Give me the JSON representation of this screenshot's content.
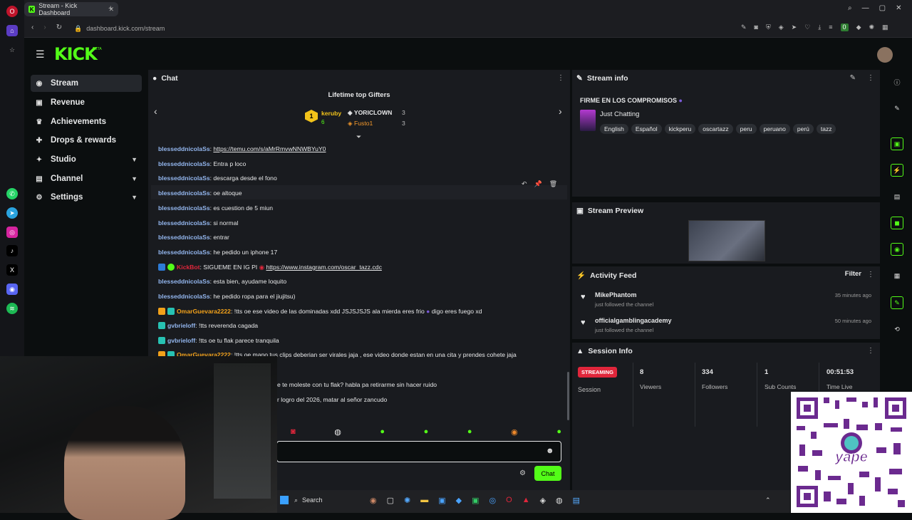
{
  "browser": {
    "tab_title": "Stream - Kick Dashboard",
    "url": "dashboard.kick.com/stream",
    "ext_badge": "0"
  },
  "brand": {
    "logo": "KICK",
    "beta": "BETA",
    "accent": "#53fc18"
  },
  "nav": [
    {
      "label": "Stream",
      "icon": "broadcast-icon",
      "active": true
    },
    {
      "label": "Revenue",
      "icon": "money-icon"
    },
    {
      "label": "Achievements",
      "icon": "trophy-icon"
    },
    {
      "label": "Drops & rewards",
      "icon": "gift-icon"
    },
    {
      "label": "Studio",
      "icon": "studio-icon",
      "expand": true
    },
    {
      "label": "Channel",
      "icon": "channel-icon",
      "expand": true
    },
    {
      "label": "Settings",
      "icon": "gear-icon",
      "expand": true
    }
  ],
  "chat": {
    "title": "Chat",
    "gifters_title": "Lifetime top Gifters",
    "gifters": [
      {
        "rank": "1",
        "name": "keruby",
        "count": "6"
      },
      {
        "name": "YORICLOWN",
        "count": "3"
      },
      {
        "name": "Fusto1",
        "count": "3"
      }
    ],
    "messages": [
      {
        "user": "blesseddnicolaSs",
        "text": "https://temu.com/s/aMrRmvwNNWBYuY0",
        "link": true
      },
      {
        "user": "blesseddnicolaSs",
        "text": "Entra p loco"
      },
      {
        "user": "blesseddnicolaSs",
        "text": "descarga desde el fono"
      },
      {
        "user": "blesseddnicolaSs",
        "text": "oe altoque"
      },
      {
        "user": "blesseddnicolaSs",
        "text": "es cuestion de 5 miun"
      },
      {
        "user": "blesseddnicolaSs",
        "text": "si normal"
      },
      {
        "user": "blesseddnicolaSs",
        "text": "entrar"
      },
      {
        "user": "blesseddnicolaSs",
        "text": "he pedido un iphone 17"
      },
      {
        "user": "KickBot",
        "text": "SIGUEME EN IG PI",
        "link_text": "https://www.instagram.com/oscar_tazz.cdc"
      },
      {
        "user": "blesseddnicolaSs",
        "text": "esta bien, ayudame loquito"
      },
      {
        "user": "blesseddnicolaSs",
        "text": "he pedido ropa para el jiujitsu)"
      },
      {
        "user": "OmarGuevara2222",
        "text": "!tts oe ese video de las dominadas xdd JSJSJSJS ala mierda eres frio",
        "text2": "digo eres fuego xd"
      },
      {
        "user": "gvbrieloff",
        "text": "!tts reverenda cagada"
      },
      {
        "user": "gvbrieloff",
        "text": "!tts oe tu flak parece tranquila"
      },
      {
        "user": "OmarGuevara2222",
        "text": "!tts oe mano tus clips deberian ser virales jaja , ese video donde estan en una cita y prendes cohete jaja"
      },
      {
        "user": "",
        "text": "e te moleste con tu flak? habla pa retirarme sin hacer ruido"
      },
      {
        "user": "",
        "text": "r logro del 2026, matar al señor zancudo"
      }
    ],
    "send_label": "Chat"
  },
  "stream_info": {
    "title": "Stream info",
    "stream_title": "FIRME EN LOS COMPROMISOS",
    "category": "Just Chatting",
    "tags": [
      "English",
      "Español",
      "kickperu",
      "oscartazz",
      "peru",
      "peruano",
      "perú",
      "tazz"
    ]
  },
  "preview": {
    "title": "Stream Preview"
  },
  "activity": {
    "title": "Activity Feed",
    "filter": "Filter",
    "items": [
      {
        "name": "MikePhantom",
        "sub": "just followed the channel",
        "time": "35 minutes ago"
      },
      {
        "name": "officialgamblingacademy",
        "sub": "just followed the channel",
        "time": "50 minutes ago"
      }
    ]
  },
  "session": {
    "title": "Session Info",
    "status": "STREAMING",
    "status_label": "Session",
    "stats": [
      {
        "value": "8",
        "label": "Viewers"
      },
      {
        "value": "334",
        "label": "Followers"
      },
      {
        "value": "1",
        "label": "Sub Counts"
      },
      {
        "value": "00:51:53",
        "label": "Time Live"
      }
    ]
  },
  "taskbar": {
    "search": "Search"
  }
}
